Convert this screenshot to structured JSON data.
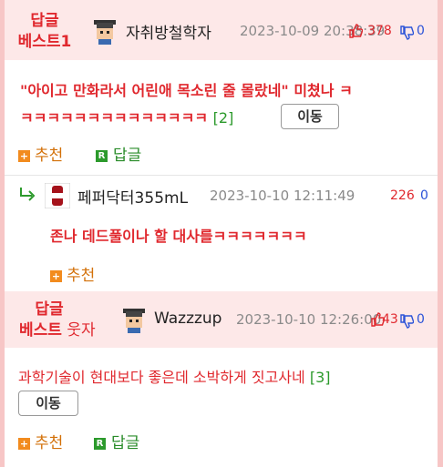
{
  "comments": [
    {
      "badge_line1": "답글",
      "badge_line2": "베스트1",
      "nickname": "자취방철학자",
      "date": "2023-10-09 20:38:39",
      "up": "378",
      "down": "0",
      "text_line1": "\"아이고 만화라서 어린애 목소린 줄 몰랐네\" 미쳤나 ㅋ",
      "text_line2": "ㅋㅋㅋㅋㅋㅋㅋㅋㅋㅋㅋㅋㅋㅋ",
      "reply_count": "[2]",
      "move_label": "이동",
      "recommend_label": "추천",
      "reply_label": "답글"
    },
    {
      "nickname": "페퍼닥터355mL",
      "date": "2023-10-10 12:11:49",
      "up": "226",
      "down": "0",
      "text": "존나 데드풀이나 할 대사를ㅋㅋㅋㅋㅋㅋㅋ",
      "recommend_label": "추천"
    },
    {
      "badge_line1": "답글",
      "badge_line2a": "베스트",
      "badge_line2b": " 웃자",
      "nickname": "Wazzzup",
      "date": "2023-10-10 12:26:00",
      "up": "43",
      "down": "0",
      "text": "과학기술이 현대보다 좋은데 소박하게 짓고사네",
      "reply_count": "[3]",
      "move_label": "이동",
      "recommend_label": "추천",
      "reply_label": "답글"
    }
  ],
  "icons": {
    "reply_arrow": "reply-arrow-icon",
    "thumb_up": "thumbs-up-icon",
    "thumb_down": "thumbs-down-icon"
  },
  "colors": {
    "accent": "#e0282e",
    "header_bg": "#fde8e8",
    "up": "#e0282e",
    "down": "#2a52d8"
  }
}
